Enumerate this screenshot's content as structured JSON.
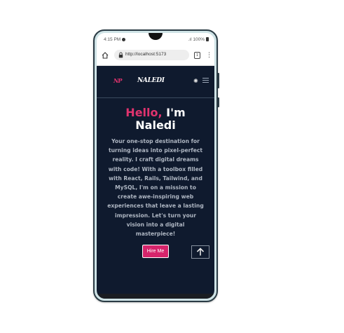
{
  "status_bar": {
    "time": "4:15 PM",
    "battery": "100%"
  },
  "browser": {
    "url": "http://localhost:5173",
    "tab_count": "1"
  },
  "site": {
    "logo": "NP",
    "brand": "NALEDI",
    "hero": {
      "greeting": "Hello,",
      "title_rest": "I'm",
      "name": "Naledi",
      "description": "Your one-stop destination for turning ideas into pixel-perfect reality. I craft digital dreams with code! With a toolbox filled with React, Rails, Tailwind, and MySQL, I'm on a mission to create awe-inspiring web experiences that leave a lasting impression. Let's turn your vision into a digital masterpiece!",
      "cta_label": "Hire Me"
    }
  },
  "colors": {
    "page_bg": "#0f1a2e",
    "accent": "#e0336e",
    "button_bg": "#d6246b",
    "text_muted": "#aeb6c2",
    "phone_frame": "#2a3b44"
  },
  "icons": {
    "home": "home-icon",
    "lock": "lock-icon",
    "tabs": "tabs-icon",
    "menu": "kebab-menu-icon",
    "theme": "sun-icon",
    "hamburger": "hamburger-icon",
    "scroll_top": "arrow-up-icon"
  }
}
